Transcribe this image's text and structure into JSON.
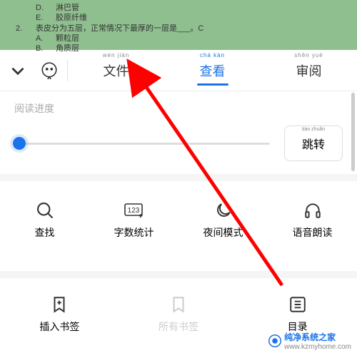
{
  "document_preview": {
    "lines": [
      {
        "letter": "D.",
        "text": "淋巴管"
      },
      {
        "letter": "E.",
        "text": "胶原纤维"
      },
      {
        "num": "2.",
        "text": "表皮分为五层，正常情况下最厚的一层是___。C"
      },
      {
        "letter": "A.",
        "text": "颗粒层"
      },
      {
        "letter": "B.",
        "text": "角质层"
      }
    ]
  },
  "tabs": {
    "file": {
      "pinyin": "wén  jiàn",
      "label": "文件"
    },
    "view": {
      "pinyin": "chá  kàn",
      "label": "查看"
    },
    "review": {
      "pinyin": "shěn  yuè",
      "label": "审阅"
    }
  },
  "progress": {
    "label": "阅读进度",
    "jump_pinyin": "tiào  zhuǎn",
    "jump_label": "跳转"
  },
  "tools_row1": {
    "find": "查找",
    "count": "字数统计",
    "night": "夜间模式",
    "voice": "语音朗读"
  },
  "tools_row2": {
    "insert_bm": "插入书签",
    "all_bm": "所有书签",
    "toc": "目录"
  },
  "watermark": {
    "brand": "纯净系统之家",
    "url": "www.kzmyhome.com"
  }
}
